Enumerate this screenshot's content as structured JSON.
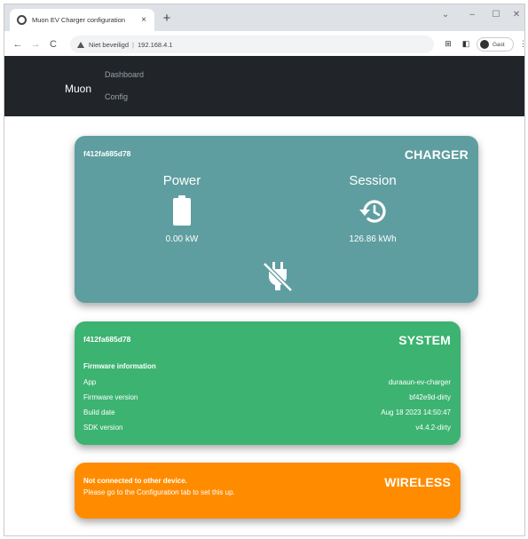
{
  "browser": {
    "tab_title": "Muon EV Charger configuration",
    "tab_close": "×",
    "new_tab": "+",
    "window_controls": [
      "⌄",
      "–",
      "☐",
      "✕"
    ],
    "nav": {
      "back": "←",
      "forward": "→",
      "reload": "C"
    },
    "security_label": "Niet beveiligd",
    "address": "192.168.4.1",
    "profile_label": "Gast"
  },
  "app": {
    "brand": "Muon",
    "nav": {
      "dashboard": "Dashboard",
      "config": "Config"
    }
  },
  "charger": {
    "device_id": "f412fa685d78",
    "title": "CHARGER",
    "power_label": "Power",
    "power_value": "0.00 kW",
    "session_label": "Session",
    "session_value": "126.86 kWh",
    "icons": [
      "battery-icon",
      "history-icon",
      "plug-disconnected-icon"
    ],
    "color": "#5f9ea0"
  },
  "system": {
    "device_id": "f412fa685d78",
    "title": "SYSTEM",
    "section_heading": "Firmware information",
    "rows": [
      {
        "key": "App",
        "value": "duraaun-ev-charger"
      },
      {
        "key": "Firmware version",
        "value": "bf42e9d-dirty"
      },
      {
        "key": "Build date",
        "value": "Aug 18 2023 14:50:47"
      },
      {
        "key": "SDK version",
        "value": "v4.4.2-dirty"
      }
    ],
    "color": "#3cb371"
  },
  "wireless": {
    "title": "WIRELESS",
    "message_line1": "Not connected to other device.",
    "message_line2": "Please go to the Configuration tab to set this up.",
    "color": "#ff8c00"
  }
}
